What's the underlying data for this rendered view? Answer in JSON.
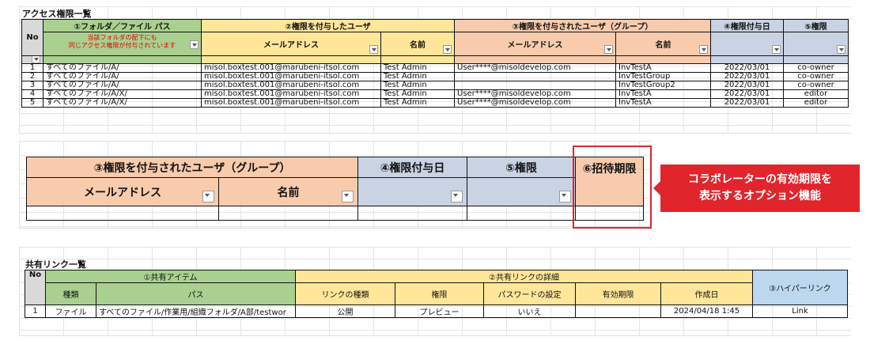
{
  "access": {
    "title": "アクセス権限一覧",
    "headers": {
      "no": "No",
      "folder_path": "①フォルダ／ファイル パス",
      "note_line1": "当該フォルダの配下にも",
      "note_line2": "同じアクセス権限が付与されています",
      "granting_user": "②権限を付与したユーザ",
      "granted_user": "③権限を付与されたユーザ（グループ）",
      "grant_date": "④権限付与日",
      "permission": "⑤権限",
      "email": "メールアドレス",
      "name": "名前"
    },
    "rows": [
      {
        "no": "1",
        "path": "すべてのファイル/A/",
        "grantor_email": "misol.boxtest.001@marubeni-itsol.com",
        "grantor_name": "Test Admin",
        "grantee_email": "User****@misoldevelop.com",
        "grantee_name": "InvTestA",
        "date": "2022/03/01",
        "permission": "co-owner"
      },
      {
        "no": "2",
        "path": "すべてのファイル/A/",
        "grantor_email": "misol.boxtest.001@marubeni-itsol.com",
        "grantor_name": "Test Admin",
        "grantee_email": "",
        "grantee_name": "InvTestGroup",
        "date": "2022/03/01",
        "permission": "co-owner"
      },
      {
        "no": "3",
        "path": "すべてのファイル/A/",
        "grantor_email": "misol.boxtest.001@marubeni-itsol.com",
        "grantor_name": "Test Admin",
        "grantee_email": "",
        "grantee_name": "InvTestGroup2",
        "date": "2022/03/01",
        "permission": "co-owner"
      },
      {
        "no": "4",
        "path": "すべてのファイル/A/X/",
        "grantor_email": "misol.boxtest.001@marubeni-itsol.com",
        "grantor_name": "Test Admin",
        "grantee_email": "User****@misoldevelop.com",
        "grantee_name": "InvTestA",
        "date": "2022/03/01",
        "permission": "editor"
      },
      {
        "no": "5",
        "path": "すべてのファイル/A/X/",
        "grantor_email": "misol.boxtest.001@marubeni-itsol.com",
        "grantor_name": "Test Admin",
        "grantee_email": "User****@misoldevelop.com",
        "grantee_name": "InvTestA",
        "date": "2022/03/01",
        "permission": "editor"
      }
    ]
  },
  "zoom": {
    "granted_user": "③権限を付与されたユーザ（グループ）",
    "grant_date": "④権限付与日",
    "permission": "⑤権限",
    "invite_expiry": "⑥招待期限",
    "email": "メールアドレス",
    "name": "名前"
  },
  "callout": {
    "line1": "コラボレーターの有効期限を",
    "line2": "表示するオプション機能",
    "color": "#e0252d"
  },
  "shared": {
    "title": "共有リンク一覧",
    "headers": {
      "no": "No",
      "shared_item": "①共有アイテム",
      "link_details": "②共有リンクの詳細",
      "hyperlink": "③ハイパーリンク",
      "type": "種類",
      "path": "パス",
      "link_type": "リンクの種類",
      "permission": "権限",
      "password": "パスワードの設定",
      "expiry": "有効期限",
      "created": "作成日"
    },
    "rows": [
      {
        "no": "1",
        "type": "ファイル",
        "path": "すべてのファイル/作業用/組織フォルダ/A部/testwor",
        "link_type": "公開",
        "permission": "プレビュー",
        "password": "いいえ",
        "expiry": "",
        "created": "2024/04/18 1:45",
        "hyperlink": "Link"
      }
    ]
  }
}
